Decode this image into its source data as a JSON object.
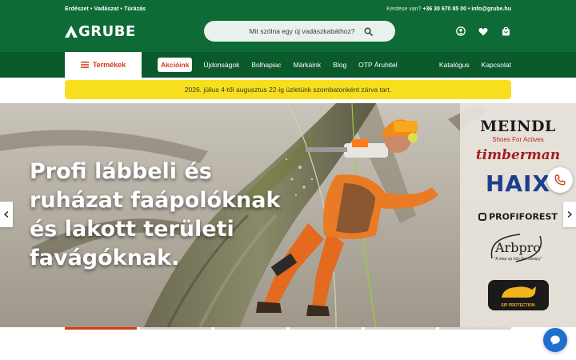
{
  "header": {
    "tagline": "Erdészet • Vadászat • Túrázás",
    "contact_question": "Kérdése van?",
    "phone": "+36 30 670 85 00",
    "separator": "•",
    "email": "info@grube.hu",
    "logo_text": "GRUBE"
  },
  "search": {
    "placeholder": "Mit szólna egy új vadászkabáthoz?"
  },
  "header_icons": [
    "user-icon",
    "heart-icon",
    "shopping-bag-icon"
  ],
  "nav": {
    "products_label": "Termékek",
    "items": [
      "Akcióink",
      "Újdonságok",
      "Bolhapiac",
      "Márkáink",
      "Blog",
      "OTP Áruhitel"
    ],
    "right_items": [
      "Katalógus",
      "Kapcsolat"
    ]
  },
  "notice": "2026. július 4-től augusztus 22-ig üzletünk szombatonként zárva tart.",
  "hero": {
    "title_lines": [
      "Profi lábbeli és",
      "ruházat faápolóknak",
      "és lakott területi",
      "favágóknak."
    ],
    "brands": [
      {
        "name": "MEINDL",
        "sub": "Shoes For Actives"
      },
      {
        "name": "timberman"
      },
      {
        "name": "HAIX"
      },
      {
        "name": "PROFIFOREST"
      },
      {
        "name": "Arbpro",
        "sub": "\"A step up into the canopy\""
      },
      {
        "name": "SIP PROTECTION"
      }
    ],
    "active_slide": 0,
    "slide_count": 6
  },
  "colors": {
    "header_green": "#0f6b36",
    "nav_green": "#0a5a2c",
    "accent_orange": "#d93b12",
    "notice_yellow": "#f7df1e",
    "chat_blue": "#1f6fd1"
  }
}
